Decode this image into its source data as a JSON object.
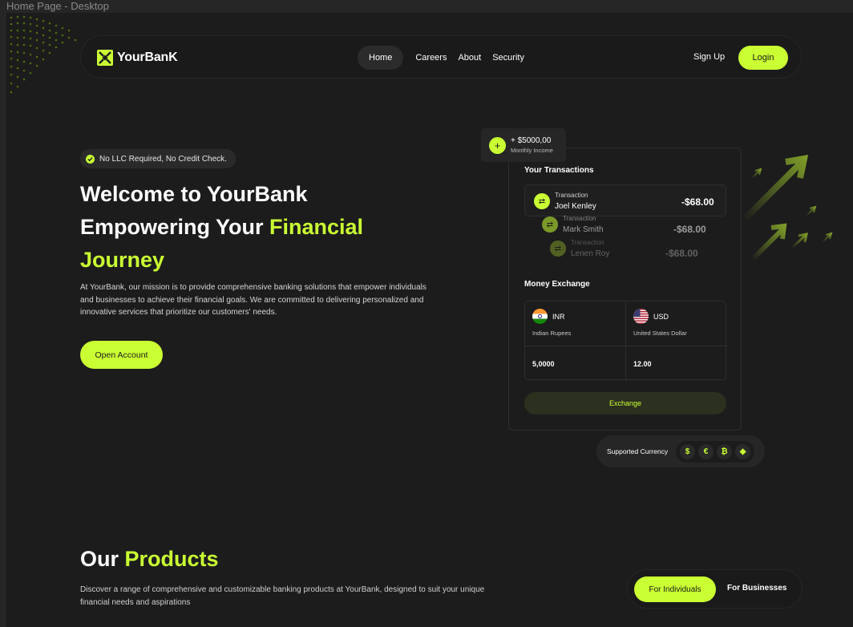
{
  "frame_label": "Home Page - Desktop",
  "nav": {
    "brand": "YourBanK",
    "links": [
      "Home",
      "Careers",
      "About",
      "Security"
    ],
    "signup": "Sign Up",
    "login": "Login"
  },
  "hero": {
    "badge": "No LLC Required, No Credit Check.",
    "title_line1": "Welcome to YourBank",
    "title_line2_prefix": "Empowering Your ",
    "title_line2_accent": "Financial",
    "title_line3_accent": "Journey",
    "description": "At YourBank, our mission is to provide comprehensive banking solutions that empower individuals and businesses to achieve their financial goals. We are committed to delivering personalized and innovative services that prioritize our customers' needs.",
    "cta": "Open Account"
  },
  "income": {
    "amount": "+ $5000,00",
    "label": "Monthly Income"
  },
  "transactions": {
    "heading": "Your Transactions",
    "items": [
      {
        "label": "Transaction",
        "name": "Joel Kenley",
        "amount": "-$68.00"
      },
      {
        "label": "Transaction",
        "name": "Mark Smith",
        "amount": "-$68.00"
      },
      {
        "label": "Transaction",
        "name": "Lenen Roy",
        "amount": "-$68.00"
      }
    ]
  },
  "exchange": {
    "heading": "Money Exchange",
    "from": {
      "code": "INR",
      "name": "Indian Rupees",
      "value": "5,0000"
    },
    "to": {
      "code": "USD",
      "name": "United States Dollar",
      "value": "12.00"
    },
    "button": "Exchange"
  },
  "supported": {
    "label": "Supported Currency",
    "icons": [
      "dollar-icon",
      "euro-icon",
      "bitcoin-icon",
      "ethereum-icon"
    ],
    "glyphs": [
      "$",
      "€",
      "₿",
      "◆"
    ]
  },
  "products": {
    "title_prefix": "Our ",
    "title_accent": "Products",
    "description": "Discover a range of comprehensive and customizable banking products at YourBank, designed to suit your unique financial needs and aspirations",
    "toggle_active": "For Individuals",
    "toggle_other": "For Businesses"
  },
  "colors": {
    "accent": "#caff33",
    "background": "#1c1c1c",
    "surface": "#262626"
  }
}
